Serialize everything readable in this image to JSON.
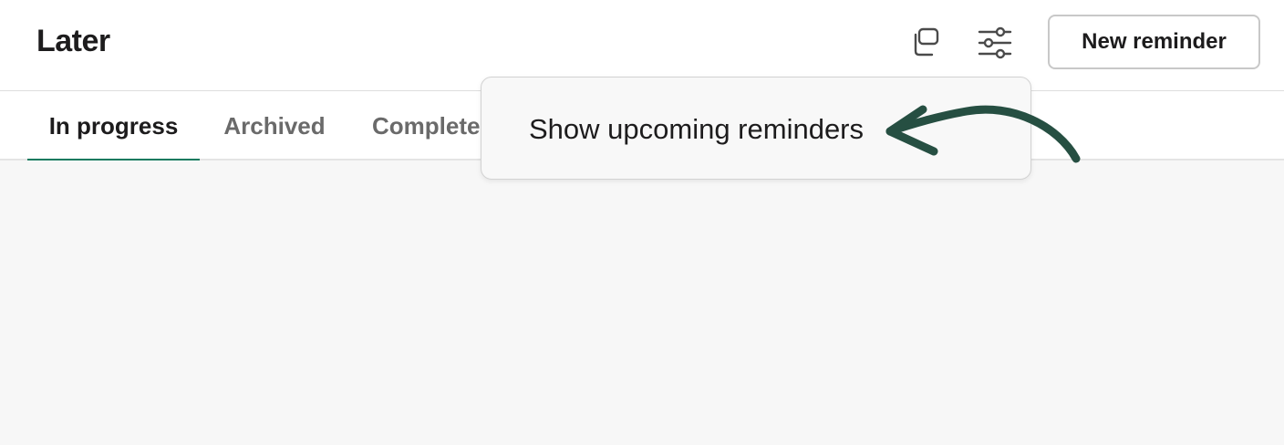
{
  "header": {
    "title": "Later",
    "new_button_label": "New reminder",
    "icons": [
      "copy-icon",
      "filter-sliders-icon"
    ]
  },
  "tabs": [
    {
      "label": "In progress",
      "active": true
    },
    {
      "label": "Archived",
      "active": false
    },
    {
      "label": "Completed",
      "active": false
    }
  ],
  "dropdown": {
    "item_label": "Show upcoming reminders"
  },
  "annotation": {
    "icon": "hand-drawn-arrow-icon"
  },
  "colors": {
    "accent": "#137a5f",
    "arrow": "#264f42",
    "content_background": "#f7f7f7"
  }
}
